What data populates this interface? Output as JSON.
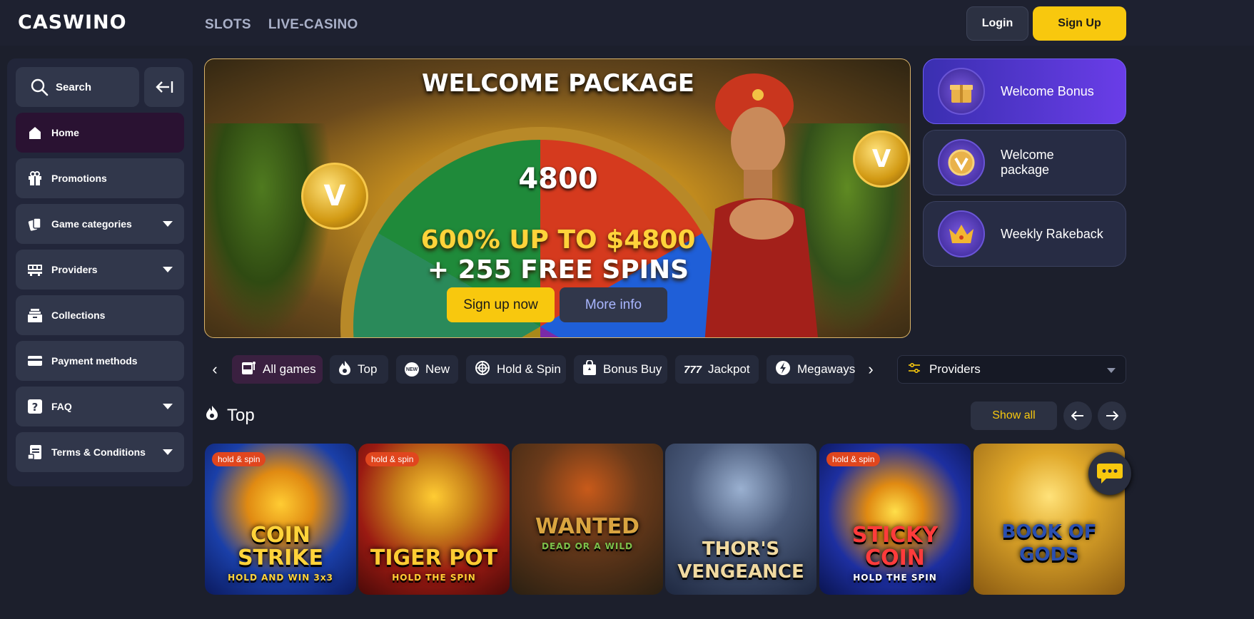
{
  "header": {
    "logo": "CASWINO",
    "nav": [
      "SLOTS",
      "LIVE-CASINO"
    ],
    "login_label": "Login",
    "signup_label": "Sign Up"
  },
  "sidebar": {
    "search_label": "Search",
    "items": [
      {
        "label": "Home",
        "icon": "home-icon",
        "active": true,
        "expandable": false
      },
      {
        "label": "Promotions",
        "icon": "gift-icon",
        "active": false,
        "expandable": false
      },
      {
        "label": "Game categories",
        "icon": "cards-icon",
        "active": false,
        "expandable": true
      },
      {
        "label": "Providers",
        "icon": "providers-icon",
        "active": false,
        "expandable": true
      },
      {
        "label": "Collections",
        "icon": "collections-icon",
        "active": false,
        "expandable": false
      },
      {
        "label": "Payment methods",
        "icon": "credit-card-icon",
        "active": false,
        "expandable": false
      },
      {
        "label": "FAQ",
        "icon": "question-icon",
        "active": false,
        "expandable": true
      },
      {
        "label": "Terms & Conditions",
        "icon": "document-icon",
        "active": false,
        "expandable": true
      }
    ]
  },
  "hero": {
    "title": "WELCOME PACKAGE",
    "wheel_value": "4800",
    "offer_line1": "600% UP TO $4800",
    "offer_line2": "+ 255 FREE SPINS",
    "signup_button": "Sign up now",
    "more_button": "More info"
  },
  "promos": [
    {
      "label": "Welcome Bonus",
      "icon": "gift-box-icon",
      "active": true
    },
    {
      "label": "Welcome package",
      "icon": "coin-icon",
      "active": false
    },
    {
      "label": "Weekly Rakeback",
      "icon": "crown-icon",
      "active": false
    }
  ],
  "categories": {
    "items": [
      "All games",
      "Top",
      "New",
      "Hold & Spin",
      "Bonus Buy",
      "Jackpot",
      "Megaways"
    ],
    "active": "All games",
    "providers_label": "Providers"
  },
  "section": {
    "title": "Top",
    "show_all_label": "Show all"
  },
  "games": [
    {
      "name": "COIN STRIKE",
      "sub": "HOLD AND WIN 3x3",
      "badge": "hold & spin",
      "bg": "#1a3fa8",
      "color": "#ffd33a"
    },
    {
      "name": "TIGER POT",
      "sub": "HOLD THE SPIN",
      "badge": "hold & spin",
      "bg": "#9a1a12",
      "color": "#ffcc33"
    },
    {
      "name": "WANTED",
      "sub": "DEAD OR A WILD",
      "badge": "",
      "bg": "#4a3a22",
      "color": "#d9a440"
    },
    {
      "name": "THOR'S VENGEANCE",
      "sub": "",
      "badge": "",
      "bg": "#3a4a66",
      "color": "#f0d9a0"
    },
    {
      "name": "STICKY COIN",
      "sub": "HOLD THE SPIN",
      "badge": "hold & spin",
      "bg": "#1d2fa0",
      "color": "#ff3b3b"
    },
    {
      "name": "BOOK OF GODS",
      "sub": "",
      "badge": "",
      "bg": "#b8861a",
      "color": "#2a4fb0"
    }
  ],
  "colors": {
    "accent": "#f8c80e",
    "background": "#1c1f2c",
    "panel": "#31374b",
    "promo_active": "#5a3de0"
  }
}
